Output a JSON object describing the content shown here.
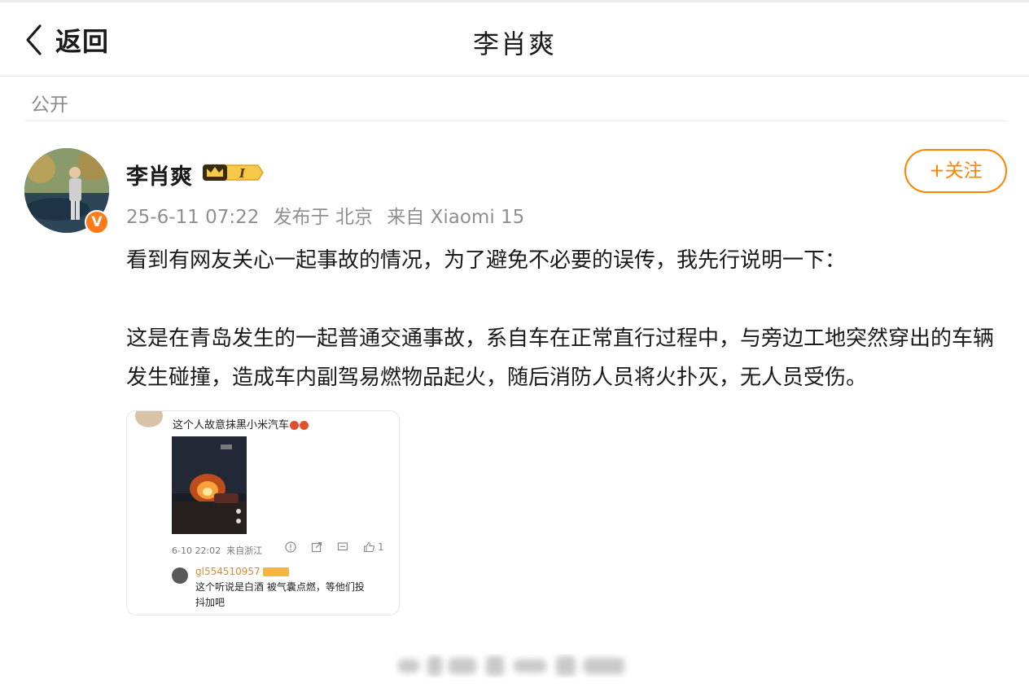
{
  "header": {
    "back_label": "返回",
    "title": "李肖爽",
    "visibility": "公开"
  },
  "post": {
    "author": "李肖爽",
    "level_badge": "I",
    "verified": true,
    "follow_label": "+关注",
    "timestamp": "25-6-11 07:22",
    "location": "发布于 北京",
    "source": "来自 Xiaomi 15",
    "paragraphs": [
      "看到有网友关心一起事故的情况，为了避免不必要的误传，我先行说明一下：",
      "这是在青岛发生的一起普通交通事故，系自车在正常直行过程中，与旁边工地突然穿出的车辆发生碰撞，造成车内副驾易燃物品起火，随后消防人员将火扑灭，无人员受伤。"
    ],
    "attachment": {
      "comment": "这个人故意抹黑小米汽车",
      "time": "6-10 22:02",
      "from": "来自浙江",
      "like_count": "1",
      "reply_user": "gl554510957",
      "reply_text": "这个听说是白酒 被气囊点燃，等他们投抖加吧"
    }
  },
  "colors": {
    "accent": "#ff8200",
    "verified": "#ff7a1a",
    "meta_text": "#8f8f8f"
  },
  "icons": [
    "chevron-left-icon",
    "crown-badge-icon",
    "verified-icon",
    "report-icon",
    "share-icon",
    "comment-icon",
    "like-icon"
  ]
}
